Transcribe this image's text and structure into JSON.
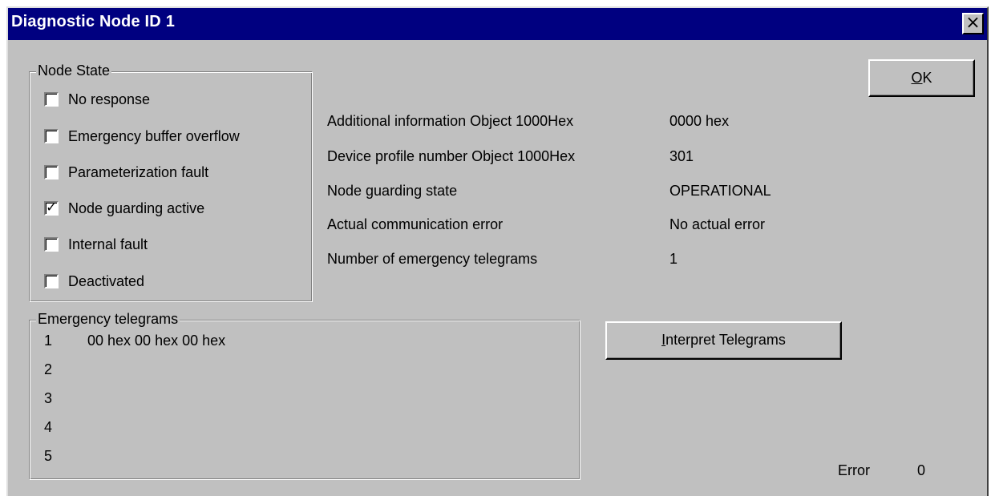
{
  "window": {
    "title": "Diagnostic Node ID 1",
    "close_glyph": "×"
  },
  "node_state": {
    "legend": "Node State",
    "items": [
      {
        "label": "No response",
        "checked": false
      },
      {
        "label": "Emergency buffer overflow",
        "checked": false
      },
      {
        "label": "Parameterization fault",
        "checked": false
      },
      {
        "label": "Node guarding active",
        "checked": true
      },
      {
        "label": "Internal fault",
        "checked": false
      },
      {
        "label": "Deactivated",
        "checked": false
      }
    ]
  },
  "info": [
    {
      "label": "Additional information Object 1000Hex",
      "value": "0000 hex"
    },
    {
      "label": "Device profile number Object 1000Hex",
      "value": "301"
    },
    {
      "label": "Node guarding state",
      "value": "OPERATIONAL"
    },
    {
      "label": "Actual communication error",
      "value": "No actual error"
    },
    {
      "label": "Number of emergency telegrams",
      "value": "1"
    }
  ],
  "emergency": {
    "legend": "Emergency telegrams",
    "rows": [
      {
        "num": "1",
        "data": "00 hex 00 hex 00 hex"
      },
      {
        "num": "2",
        "data": ""
      },
      {
        "num": "3",
        "data": ""
      },
      {
        "num": "4",
        "data": ""
      },
      {
        "num": "5",
        "data": ""
      }
    ]
  },
  "buttons": {
    "ok": {
      "mnemonic": "O",
      "rest": "K"
    },
    "interpret": {
      "mnemonic": "I",
      "rest": "nterpret Telegrams"
    }
  },
  "status": {
    "error_label": "Error",
    "error_value": "0"
  },
  "colors": {
    "titlebar": "#000080",
    "face": "#c0c0c0"
  }
}
